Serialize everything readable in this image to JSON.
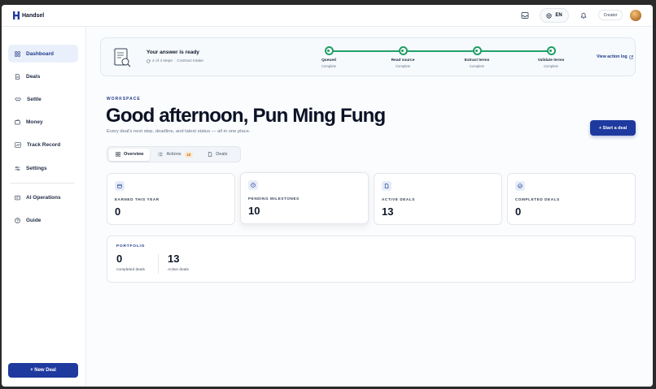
{
  "app": {
    "name": "Handsel"
  },
  "topbar": {
    "language": "EN",
    "role": "Creator"
  },
  "sidebar": {
    "items": [
      {
        "label": "Dashboard",
        "icon": "grid-icon",
        "active": true
      },
      {
        "label": "Deals",
        "icon": "document-icon"
      },
      {
        "label": "Settle",
        "icon": "handshake-icon"
      },
      {
        "label": "Money",
        "icon": "wallet-icon"
      },
      {
        "label": "Track Record",
        "icon": "chart-icon"
      },
      {
        "label": "Settings",
        "icon": "sliders-icon"
      },
      {
        "label": "AI Operations",
        "icon": "ai-chip-icon"
      },
      {
        "label": "Guide",
        "icon": "help-circle-icon"
      }
    ],
    "new_deal": "+ New Deal"
  },
  "answer": {
    "title": "Your answer is ready",
    "progress": "4 of 4 steps",
    "separator": "·",
    "context": "Contract Intake",
    "action_log": "View action log",
    "steps": [
      {
        "title": "Queued",
        "status": "Complete"
      },
      {
        "title": "Read source",
        "status": "Complete"
      },
      {
        "title": "Extract terms",
        "status": "Complete"
      },
      {
        "title": "Validate terms",
        "status": "Complete"
      }
    ]
  },
  "header": {
    "kicker": "WORKSPACE",
    "greeting": "Good afternoon, Pun Ming Fung",
    "subtitle": "Every deal's next step, deadline, and latest status — all in one place.",
    "start_deal": "+ Start a deal"
  },
  "tabs": [
    {
      "label": "Overview",
      "active": true
    },
    {
      "label": "Actions",
      "badge": "10"
    },
    {
      "label": "Deals"
    }
  ],
  "stats": [
    {
      "label": "EARNED THIS YEAR",
      "value": "0"
    },
    {
      "label": "PENDING MILESTONES",
      "value": "10"
    },
    {
      "label": "ACTIVE DEALS",
      "value": "13"
    },
    {
      "label": "COMPLETED DEALS",
      "value": "0"
    }
  ],
  "portfolio": {
    "kicker": "PORTFOLIO",
    "completed_value": "0",
    "completed_label": "completed deals",
    "active_value": "13",
    "active_label": "Active deals"
  },
  "colors": {
    "primary": "#1e3a9e",
    "success": "#1f9d63",
    "badge_bg": "#fde7c7"
  }
}
